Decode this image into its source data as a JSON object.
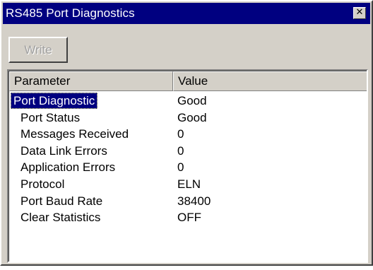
{
  "window": {
    "title": "RS485 Port Diagnostics",
    "close_glyph": "✕"
  },
  "toolbar": {
    "write_label": "Write"
  },
  "table": {
    "columns": [
      "Parameter",
      "Value"
    ],
    "rows": [
      {
        "parameter": "Port Diagnostic",
        "value": "Good",
        "selected": true
      },
      {
        "parameter": "Port Status",
        "value": "Good"
      },
      {
        "parameter": "Messages Received",
        "value": "0"
      },
      {
        "parameter": "Data Link Errors",
        "value": "0"
      },
      {
        "parameter": "Application Errors",
        "value": "0"
      },
      {
        "parameter": "Protocol",
        "value": "ELN"
      },
      {
        "parameter": "Port Baud Rate",
        "value": "38400"
      },
      {
        "parameter": "Clear Statistics",
        "value": "OFF"
      }
    ]
  },
  "colors": {
    "title_bar": "#000080",
    "selection": "#000080",
    "face": "#d4d0c8"
  }
}
